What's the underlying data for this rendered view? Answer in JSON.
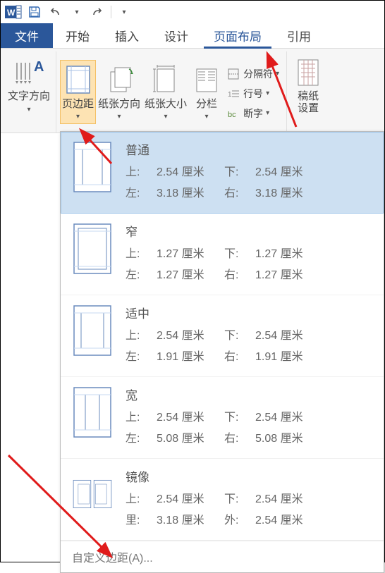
{
  "qat": {
    "undo": "↶",
    "redo": "↷"
  },
  "tabs": {
    "file": "文件",
    "home": "开始",
    "insert": "插入",
    "design": "设计",
    "layout": "页面布局",
    "references": "引用"
  },
  "ribbon": {
    "textDirection": "文字方向",
    "margins": "页边距",
    "orientation": "纸张方向",
    "size": "纸张大小",
    "columns": "分栏",
    "breaks": "分隔符",
    "lineNumbers": "行号",
    "hyphenation": "断字",
    "manuscript": "稿纸\n设置"
  },
  "labels": {
    "top": "上:",
    "bottom": "下:",
    "left": "左:",
    "right": "右:",
    "inside": "里:",
    "outside": "外:"
  },
  "presets": [
    {
      "name": "普通",
      "t": "2.54 厘米",
      "b": "2.54 厘米",
      "l": "3.18 厘米",
      "r": "3.18 厘米",
      "type": "normal",
      "selected": true
    },
    {
      "name": "窄",
      "t": "1.27 厘米",
      "b": "1.27 厘米",
      "l": "1.27 厘米",
      "r": "1.27 厘米",
      "type": "narrow",
      "selected": false
    },
    {
      "name": "适中",
      "t": "2.54 厘米",
      "b": "2.54 厘米",
      "l": "1.91 厘米",
      "r": "1.91 厘米",
      "type": "moderate",
      "selected": false
    },
    {
      "name": "宽",
      "t": "2.54 厘米",
      "b": "2.54 厘米",
      "l": "5.08 厘米",
      "r": "5.08 厘米",
      "type": "wide",
      "selected": false
    },
    {
      "name": "镜像",
      "t": "2.54 厘米",
      "b": "2.54 厘米",
      "l": "3.18 厘米",
      "r": "2.54 厘米",
      "type": "mirror",
      "selected": false
    }
  ],
  "footer": {
    "custom": "自定义边距(A)..."
  },
  "colors": {
    "accent": "#2b579a",
    "highlight": "#cde0f2",
    "arrow": "#e01b1b"
  }
}
